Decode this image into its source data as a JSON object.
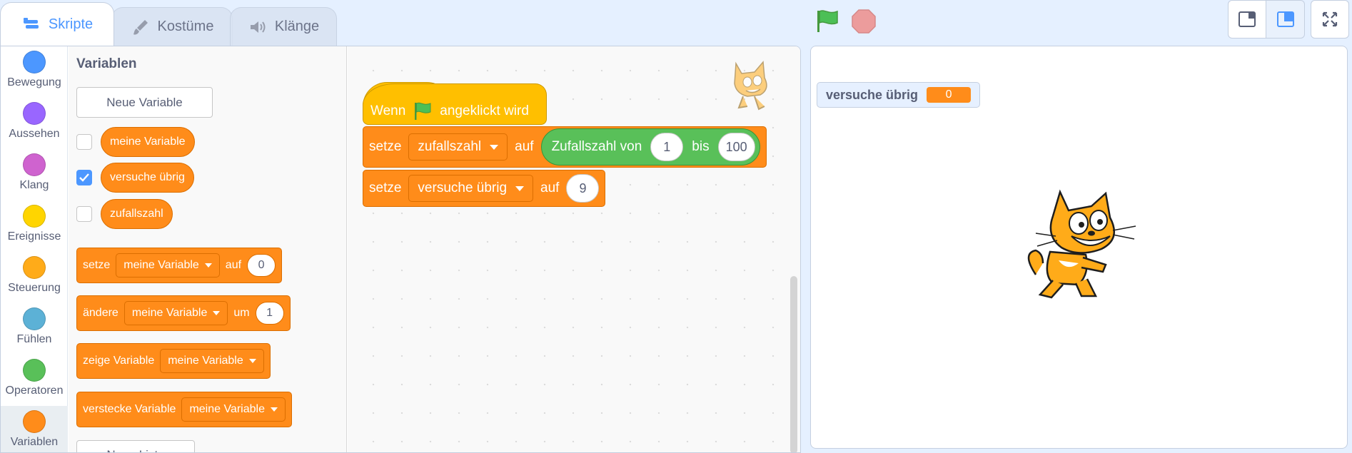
{
  "tabs": {
    "code": "Skripte",
    "costumes": "Kostüme",
    "sounds": "Klänge"
  },
  "categories": [
    {
      "label": "Bewegung",
      "color": "#4c97ff"
    },
    {
      "label": "Aussehen",
      "color": "#9966ff"
    },
    {
      "label": "Klang",
      "color": "#cf63cf"
    },
    {
      "label": "Ereignisse",
      "color": "#ffd500"
    },
    {
      "label": "Steuerung",
      "color": "#ffab19"
    },
    {
      "label": "Fühlen",
      "color": "#5cb1d6"
    },
    {
      "label": "Operatoren",
      "color": "#59c059"
    },
    {
      "label": "Variablen",
      "color": "#ff8c1a"
    }
  ],
  "palette": {
    "title": "Variablen",
    "new_variable": "Neue Variable",
    "new_list": "Neue Liste",
    "variables": [
      {
        "name": "meine Variable",
        "checked": false
      },
      {
        "name": "versuche übrig",
        "checked": true
      },
      {
        "name": "zufallszahl",
        "checked": false
      }
    ],
    "set_block": {
      "verb": "setze",
      "var": "meine Variable",
      "prep": "auf",
      "value": "0"
    },
    "change_block": {
      "verb": "ändere",
      "var": "meine Variable",
      "prep": "um",
      "value": "1"
    },
    "show_block": {
      "verb": "zeige Variable",
      "var": "meine Variable"
    },
    "hide_block": {
      "verb": "verstecke Variable",
      "var": "meine Variable"
    }
  },
  "script": {
    "hat": {
      "prefix": "Wenn",
      "suffix": "angeklickt wird"
    },
    "block1": {
      "verb": "setze",
      "var": "zufallszahl",
      "prep": "auf",
      "op_label": "Zufallszahl von",
      "from": "1",
      "mid": "bis",
      "to": "100"
    },
    "block2": {
      "verb": "setze",
      "var": "versuche übrig",
      "prep": "auf",
      "value": "9"
    }
  },
  "stage": {
    "monitor_label": "versuche übrig",
    "monitor_value": "0"
  },
  "colors": {
    "variables": "#ff8c1a",
    "events": "#ffbf00",
    "operators": "#59c059",
    "accent": "#4c97ff"
  }
}
